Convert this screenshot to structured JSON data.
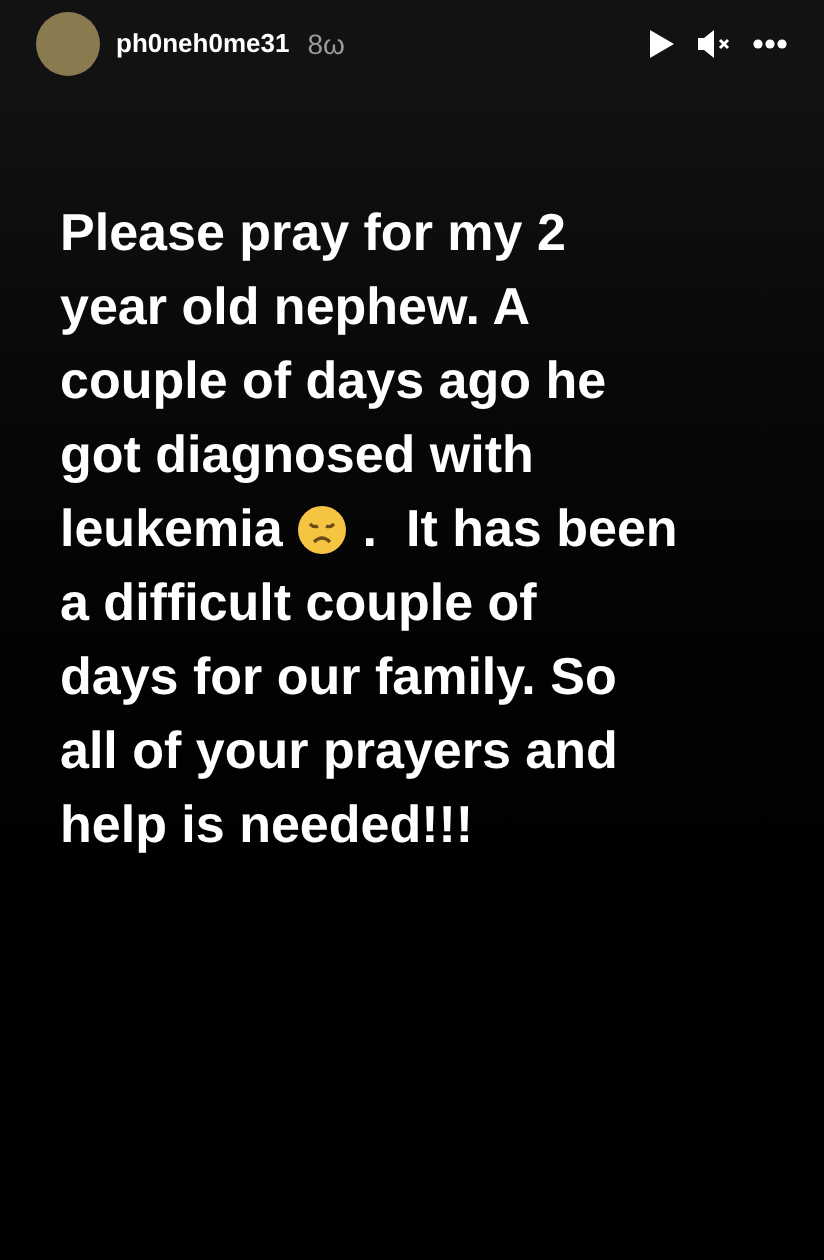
{
  "header": {
    "username": "ph0neh0me31",
    "time": "8ω"
  },
  "story": {
    "lines": [
      {
        "kind": "text",
        "text": "Please pray for my 2"
      },
      {
        "kind": "text",
        "text": "year old nephew. A"
      },
      {
        "kind": "text",
        "text": "couple of days ago he"
      },
      {
        "kind": "text",
        "text": "got diagnosed with"
      },
      {
        "kind": "emoji",
        "before": "leukemia",
        "after": ".  It has been"
      },
      {
        "kind": "text",
        "text": "a difficult couple of"
      },
      {
        "kind": "text",
        "text": "days for our family. So"
      },
      {
        "kind": "text",
        "text": "all of your prayers and"
      },
      {
        "kind": "text",
        "text": "help is needed!!!"
      }
    ]
  }
}
